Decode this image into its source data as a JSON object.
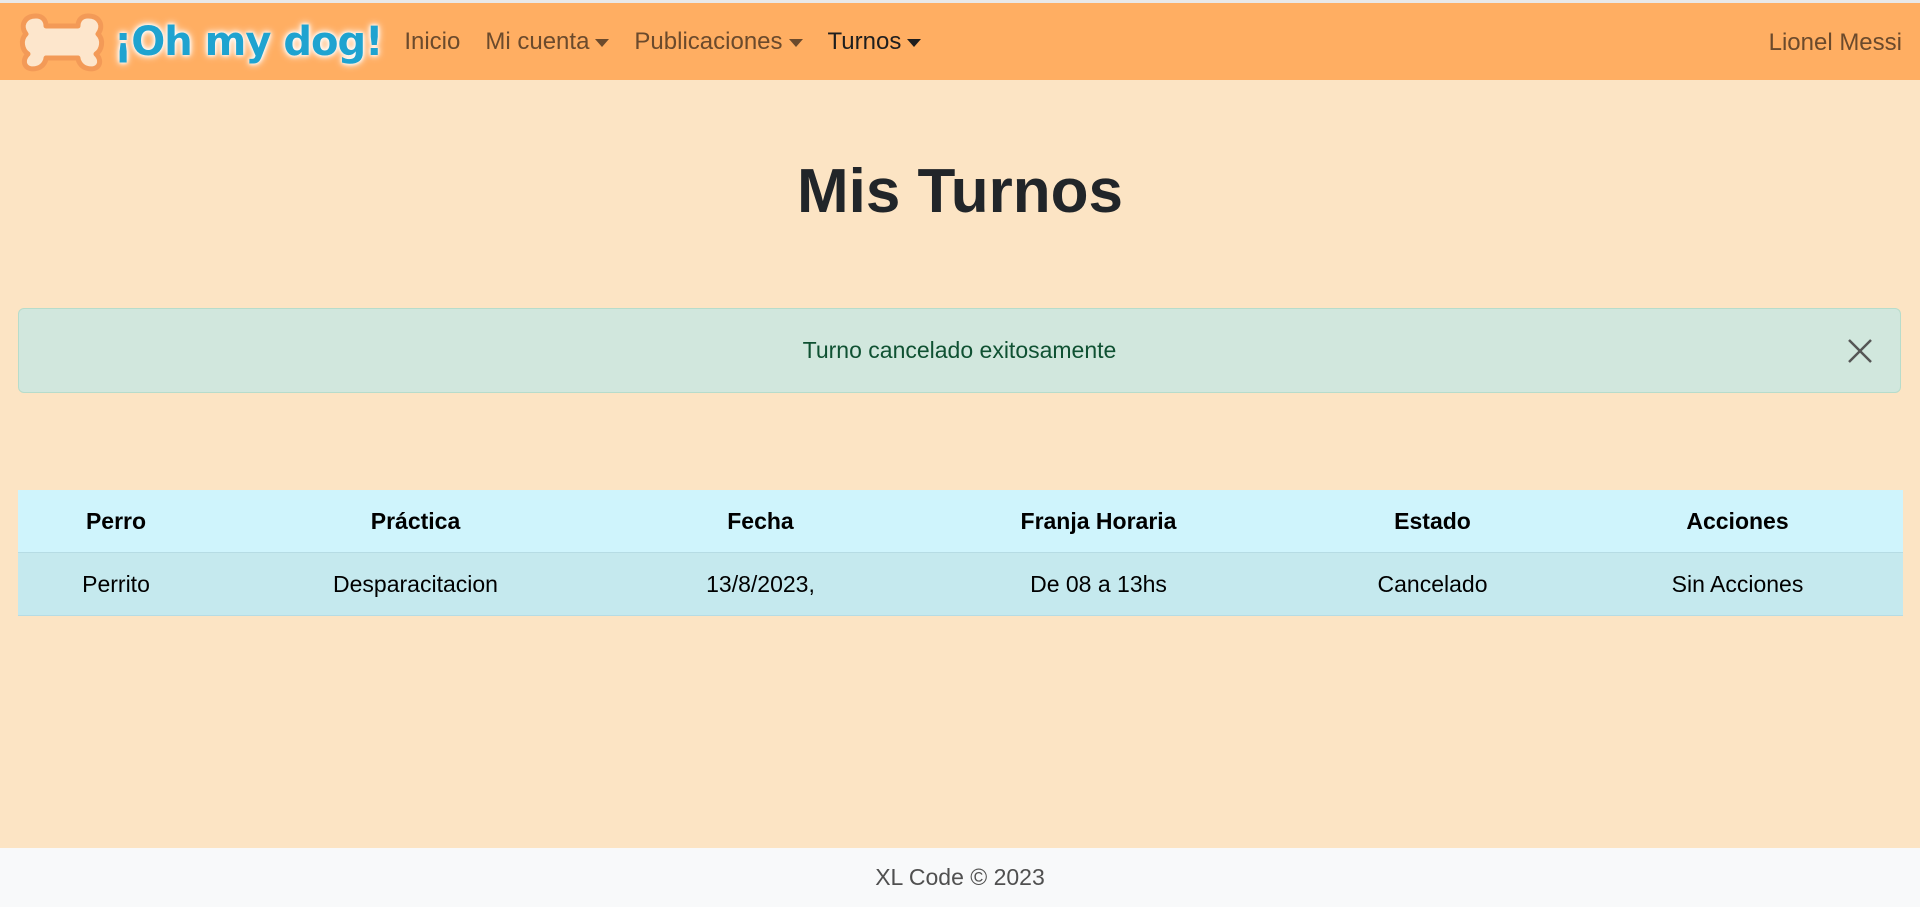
{
  "brand": {
    "name": "¡Oh my dog!",
    "logo_icon": "bone-icon"
  },
  "nav": {
    "items": [
      {
        "label": "Inicio",
        "dropdown": false,
        "active": false
      },
      {
        "label": "Mi cuenta",
        "dropdown": true,
        "active": false
      },
      {
        "label": "Publicaciones",
        "dropdown": true,
        "active": false
      },
      {
        "label": "Turnos",
        "dropdown": true,
        "active": true
      }
    ],
    "user": "Lionel Messi"
  },
  "page": {
    "title": "Mis Turnos"
  },
  "alert": {
    "message": "Turno cancelado exitosamente",
    "close_icon": "close-icon"
  },
  "table": {
    "headers": [
      "Perro",
      "Práctica",
      "Fecha",
      "Franja Horaria",
      "Estado",
      "Acciones"
    ],
    "rows": [
      [
        "Perrito",
        "Desparacitacion",
        "13/8/2023,",
        "De 08 a 13hs",
        "Cancelado",
        "Sin Acciones"
      ]
    ]
  },
  "footer": {
    "text": "XL Code © 2023"
  },
  "colors": {
    "navbar": "#ffae62",
    "background": "#fce4c4",
    "alert_bg": "#d1e7dd",
    "table_header_bg": "#cff4fc",
    "table_row_bg": "#c5e9ee",
    "footer_bg": "#f8f9fa",
    "brand_text": "#1fa3d0"
  }
}
